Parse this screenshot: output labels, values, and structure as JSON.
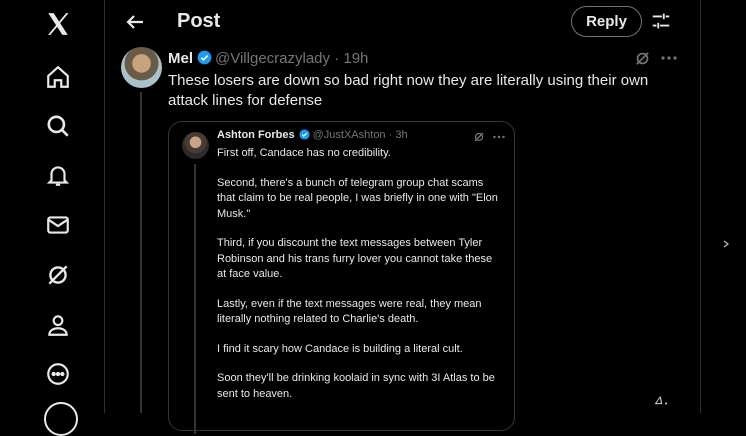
{
  "header": {
    "title": "Post",
    "reply_label": "Reply"
  },
  "sidebar": {
    "icons": [
      "x-logo-icon",
      "home-icon",
      "search-icon",
      "notifications-icon",
      "messages-icon",
      "grok-icon",
      "profile-icon",
      "more-icon"
    ]
  },
  "post": {
    "name": "Mel",
    "handle": "@Villgecrazylady",
    "time": "· 19h",
    "text": "These losers are down so bad right now they are literally using their own attack lines for defense"
  },
  "quote": {
    "name": "Ashton Forbes",
    "handle": "@JustXAshton",
    "time": "· 3h",
    "paragraphs": [
      "First off, Candace has no credibility.",
      "Second, there's a bunch of telegram group chat scams that claim to be real people, I was briefly in one with \"Elon Musk.\"",
      "Third, if you discount the text messages between Tyler Robinson and his trans furry lover you cannot take these at face value.",
      "Lastly, even if the text messages were real, they mean literally nothing related to Charlie's death.",
      "I find it scary how Candace is building a literal cult.",
      "Soon they'll be drinking koolaid in sync with 3I Atlas to be sent to heaven."
    ]
  },
  "colors": {
    "background": "#000000",
    "text": "#e7e9ea",
    "muted": "#71767b",
    "verified": "#1d9bf0",
    "border": "#2f3336"
  }
}
